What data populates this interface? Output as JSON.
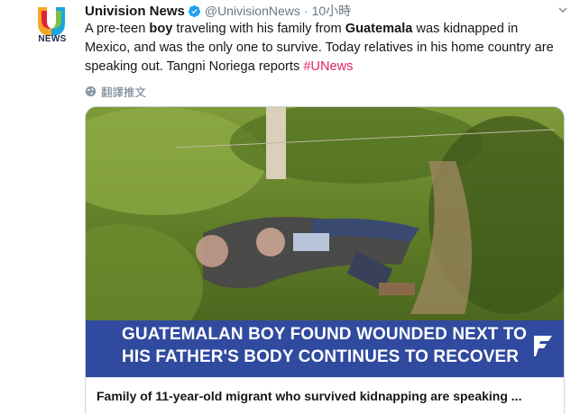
{
  "account": {
    "display_name": "Univision News",
    "handle": "@UnivisionNews",
    "separator": "·",
    "timestamp": "10小時",
    "avatar_label": "NEWS",
    "verified": true
  },
  "tweet": {
    "text_1": "A pre-teen ",
    "bold_1": "boy",
    "text_2": " traveling with his family from ",
    "bold_2": "Guatemala",
    "text_3": " was kidnapped in Mexico, and was the only one to survive. Today relatives in his home country are speaking out. Tangni Noriega reports ",
    "hashtag": "#UNews",
    "translate_label": "翻譯推文"
  },
  "card": {
    "banner_line_1": "GUATEMALAN BOY FOUND WOUNDED NEXT TO",
    "banner_line_2": "HIS FATHER'S BODY CONTINUES TO RECOVER",
    "title": "Family of 11-year-old migrant who survived kidnapping are speaking ..."
  },
  "colors": {
    "hashtag": "#e0245e",
    "verified": "#1da1f2",
    "banner": "#2f4a9e",
    "secondary_text": "#657786"
  },
  "icons": {
    "verified": "verified-badge-icon",
    "translate": "globe-icon",
    "caret": "chevron-down-icon",
    "banner_logo": "fusion-logo-icon"
  }
}
